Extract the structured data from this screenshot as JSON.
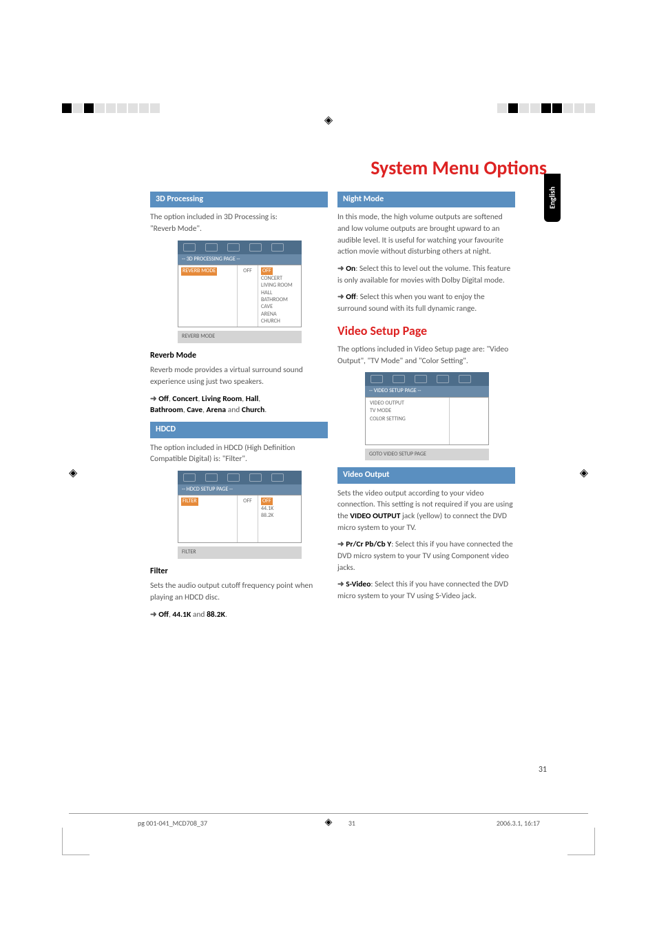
{
  "title": "System Menu Options",
  "lang_tab": "English",
  "page_number": "31",
  "footer": {
    "file": "pg 001-041_MCD708_37",
    "page": "31",
    "date": "2006.3.1, 16:17"
  },
  "left": {
    "sec1": {
      "bar": "3D Processing",
      "p1a": "The option included in 3D Processing is:",
      "p1b": "\"Reverb Mode\".",
      "mini": {
        "title": "-- 3D PROCESSING PAGE --",
        "row_label": "REVERB MODE",
        "row_val": "OFF",
        "opts": [
          "OFF",
          "CONCERT",
          "LIVING ROOM",
          "HALL",
          "BATHROOM",
          "CAVE",
          "ARENA",
          "CHURCH"
        ],
        "footer": "REVERB MODE"
      },
      "sub": "Reverb Mode",
      "p2": "Reverb mode provides a virtual surround sound experience using just two speakers.",
      "opts_pre": "➜ ",
      "opts1": "Off",
      "opts2": "Concert",
      "opts3": "Living Room",
      "opts4": "Hall",
      "opts5": "Bathroom",
      "opts6": "Cave",
      "opts7": "Arena",
      "opts_and": " and ",
      "opts8": "Church",
      "sep1": ", ",
      "dot": "."
    },
    "sec2": {
      "bar": "HDCD",
      "p1": "The option included in HDCD (High Definition Compatible Digital) is:  \"Filter\".",
      "mini": {
        "title": "-- HDCD SETUP PAGE --",
        "row_label": "FILTER",
        "row_val": "OFF",
        "opts": [
          "OFF",
          "44.1K",
          "88.2K"
        ],
        "footer": "FILTER"
      },
      "sub": "Filter",
      "p2": "Sets the audio output cutoff frequency point when playing an HDCD disc.",
      "opts_pre": "➜ ",
      "o1": "Off",
      "o2": "44.1K",
      "o3": "88.2K",
      "and": " and ",
      "sep": ", ",
      "dot": "."
    }
  },
  "right": {
    "sec1": {
      "bar": "Night Mode",
      "p1": "In this mode, the high volume outputs are softened and low volume outputs are brought upward to an audible level. It is useful for watching your favourite action movie without disturbing others at night.",
      "on_pre": "➜ ",
      "on_b": "On",
      "on_txt": ": Select this to level out the volume. This feature is only available for movies with Dolby Digital mode.",
      "off_pre": "➜ ",
      "off_b": "Off",
      "off_txt": ": Select this when you want to enjoy the surround sound with its full dynamic range."
    },
    "h2": "Video Setup Page",
    "p_vs": "The options included in Video Setup page are: \"Video Output\", \"TV Mode\" and \"Color Setting\".",
    "mini": {
      "title": "-- VIDEO SETUP PAGE --",
      "items": [
        "VIDEO OUTPUT",
        "TV MODE",
        "COLOR SETTING"
      ],
      "footer": "GOTO VIDEO SETUP PAGE"
    },
    "sec2": {
      "bar": "Video Output",
      "p1a": "Sets the video output according to your video connection. This setting is not required if you are using the ",
      "p1b": "VIDEO OUTPUT",
      "p1c": " jack (yellow) to connect the DVD micro system to your TV.",
      "pr_pre": "➜ ",
      "pr_b": "Pr/Cr Pb/Cb Y",
      "pr_txt": ": Select this if you have connected the DVD micro system to your TV using Component video jacks.",
      "sv_pre": "➜ ",
      "sv_b": "S-Video",
      "sv_txt": ": Select this if you have connected the DVD micro system to your TV using S-Video jack."
    }
  }
}
